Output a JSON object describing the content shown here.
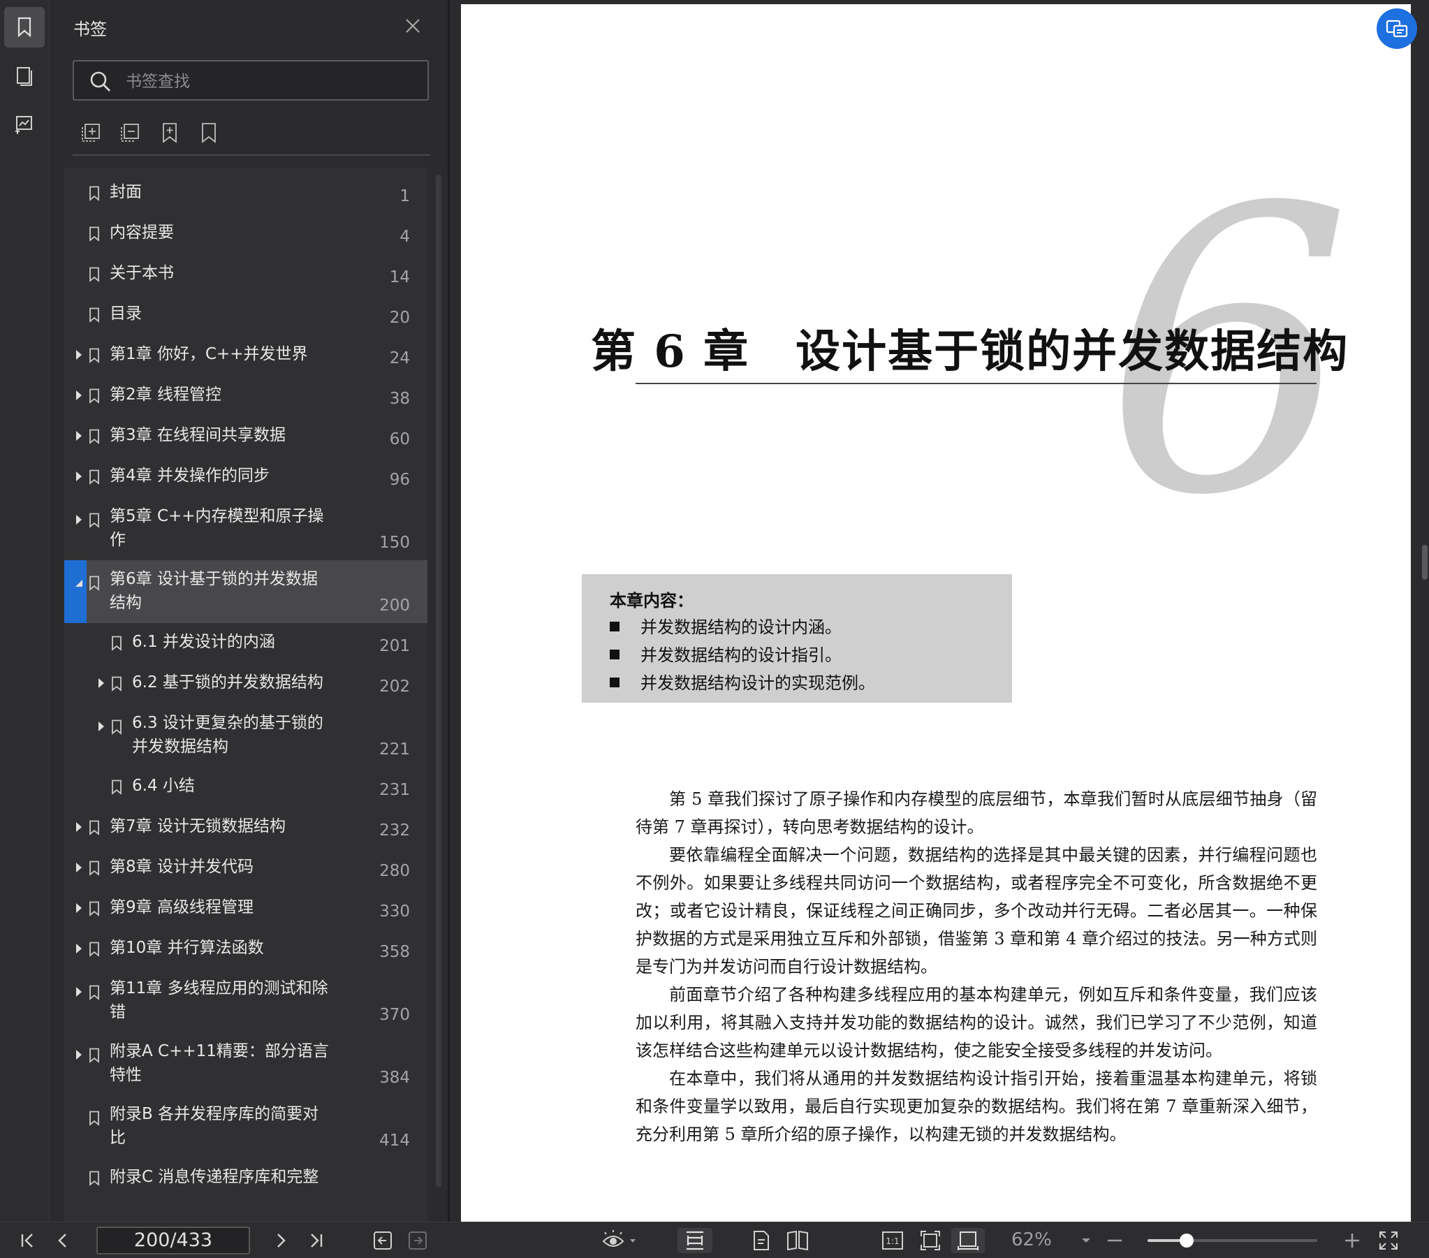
{
  "sidebar_panel": {
    "title": "书签",
    "search_placeholder": "书签查找",
    "items": [
      {
        "label": "封面",
        "page": "1",
        "level": 0,
        "arrow": "none"
      },
      {
        "label": "内容提要",
        "page": "4",
        "level": 0,
        "arrow": "none"
      },
      {
        "label": "关于本书",
        "page": "14",
        "level": 0,
        "arrow": "none"
      },
      {
        "label": "目录",
        "page": "20",
        "level": 0,
        "arrow": "none"
      },
      {
        "label": "第1章 你好，C++并发世界",
        "page": "24",
        "level": 0,
        "arrow": "collapsed"
      },
      {
        "label": "第2章 线程管控",
        "page": "38",
        "level": 0,
        "arrow": "collapsed"
      },
      {
        "label": "第3章 在线程间共享数据",
        "page": "60",
        "level": 0,
        "arrow": "collapsed"
      },
      {
        "label": "第4章 并发操作的同步",
        "page": "96",
        "level": 0,
        "arrow": "collapsed"
      },
      {
        "label": "第5章 C++内存模型和原子操\n作",
        "page": "150",
        "level": 0,
        "arrow": "collapsed"
      },
      {
        "label": "第6章 设计基于锁的并发数据\n结构",
        "page": "200",
        "level": 0,
        "arrow": "expanded",
        "selected": true
      },
      {
        "label": "6.1 并发设计的内涵",
        "page": "201",
        "level": 1,
        "arrow": "none"
      },
      {
        "label": "6.2 基于锁的并发数据结构",
        "page": "202",
        "level": 1,
        "arrow": "collapsed"
      },
      {
        "label": "6.3 设计更复杂的基于锁的\n并发数据结构",
        "page": "221",
        "level": 1,
        "arrow": "collapsed"
      },
      {
        "label": "6.4 小结",
        "page": "231",
        "level": 1,
        "arrow": "none"
      },
      {
        "label": "第7章 设计无锁数据结构",
        "page": "232",
        "level": 0,
        "arrow": "collapsed"
      },
      {
        "label": "第8章 设计并发代码",
        "page": "280",
        "level": 0,
        "arrow": "collapsed"
      },
      {
        "label": "第9章 高级线程管理",
        "page": "330",
        "level": 0,
        "arrow": "collapsed"
      },
      {
        "label": "第10章 并行算法函数",
        "page": "358",
        "level": 0,
        "arrow": "collapsed"
      },
      {
        "label": "第11章 多线程应用的测试和除\n错",
        "page": "370",
        "level": 0,
        "arrow": "collapsed"
      },
      {
        "label": "附录A C++11精要：部分语言\n特性",
        "page": "384",
        "level": 0,
        "arrow": "collapsed"
      },
      {
        "label": "附录B 各并发程序库的简要对\n比",
        "page": "414",
        "level": 0,
        "arrow": "none"
      },
      {
        "label": "附录C 消息传递程序库和完整",
        "page": "",
        "level": 0,
        "arrow": "none"
      }
    ]
  },
  "document": {
    "big_numeral": "6",
    "chapter_title": "第 6 章　设计基于锁的并发数据结构",
    "summary_heading": "本章内容：",
    "summary_points": [
      "并发数据结构的设计内涵。",
      "并发数据结构的设计指引。",
      "并发数据结构设计的实现范例。"
    ],
    "paragraphs": [
      "第 5 章我们探讨了原子操作和内存模型的底层细节，本章我们暂时从底层细节抽身（留待第 7 章再探讨），转向思考数据结构的设计。",
      "要依靠编程全面解决一个问题，数据结构的选择是其中最关键的因素，并行编程问题也不例外。如果要让多线程共同访问一个数据结构，或者程序完全不可变化，所含数据绝不更改；或者它设计精良，保证线程之间正确同步，多个改动并行无碍。二者必居其一。一种保护数据的方式是采用独立互斥和外部锁，借鉴第 3 章和第 4 章介绍过的技法。另一种方式则是专门为并发访问而自行设计数据结构。",
      "前面章节介绍了各种构建多线程应用的基本构建单元，例如互斥和条件变量，我们应该加以利用，将其融入支持并发功能的数据结构的设计。诚然，我们已学习了不少范例，知道该怎样结合这些构建单元以设计数据结构，使之能安全接受多线程的并发访问。",
      "在本章中，我们将从通用的并发数据结构设计指引开始，接着重温基本构建单元，将锁和条件变量学以致用，最后自行实现更加复杂的数据结构。我们将在第 7 章重新深入细节，充分利用第 5 章所介绍的原子操作，以构建无锁的并发数据结构。"
    ]
  },
  "bottom_bar": {
    "page_indicator": "200/433",
    "zoom": "62%",
    "zoom_fraction": 0.23,
    "fit_actual_label": "1:1"
  },
  "colors": {
    "accent": "#1f6ed4",
    "panel_bg": "#2b2b2d",
    "selected_row": "#48484b"
  }
}
